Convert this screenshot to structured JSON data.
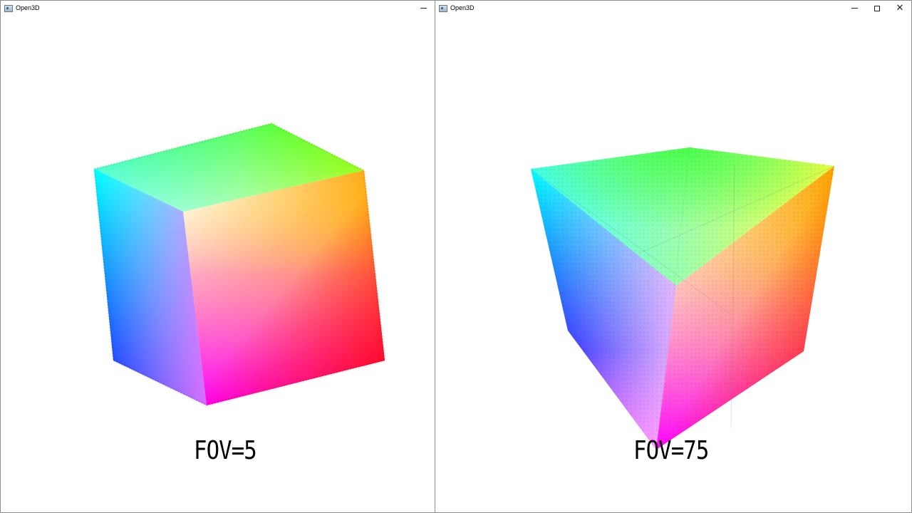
{
  "windows": [
    {
      "title": "Open3D",
      "fov_label": "FOV=5",
      "buttons": {
        "minimize": "minimize"
      }
    },
    {
      "title": "Open3D",
      "fov_label": "FOV=75",
      "buttons": {
        "minimize": "minimize",
        "maximize": "maximize",
        "close": "close"
      }
    }
  ],
  "icons": [
    "open3d-app-icon",
    "minimize-icon",
    "maximize-icon",
    "close-icon"
  ],
  "colors": {
    "cube_white": "#ffffff",
    "cube_cyan": "#00ffff",
    "cube_green": "#00ff00",
    "cube_yellow": "#ffff00",
    "cube_magenta": "#ff00ff",
    "cube_red": "#ff0000",
    "cube_blue": "#0000ff"
  }
}
